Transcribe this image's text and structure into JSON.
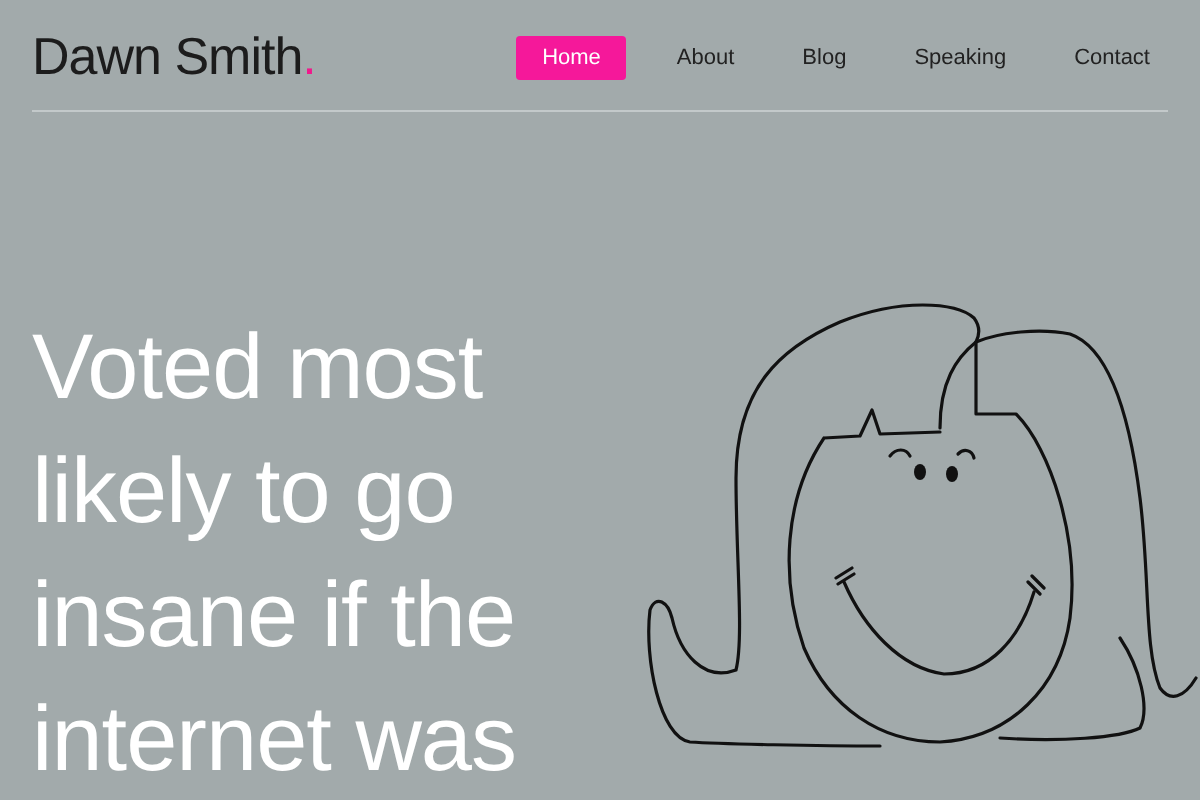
{
  "header": {
    "logo": {
      "name": "Dawn Smith",
      "mark": "."
    },
    "nav": [
      {
        "label": "Home",
        "selected": true
      },
      {
        "label": "About",
        "selected": false
      },
      {
        "label": "Blog",
        "selected": false
      },
      {
        "label": "Speaking",
        "selected": false
      },
      {
        "label": "Contact",
        "selected": false
      }
    ]
  },
  "hero": {
    "headline_lines": [
      "Voted most",
      "likely to go",
      "insane if the",
      "internet was"
    ]
  }
}
